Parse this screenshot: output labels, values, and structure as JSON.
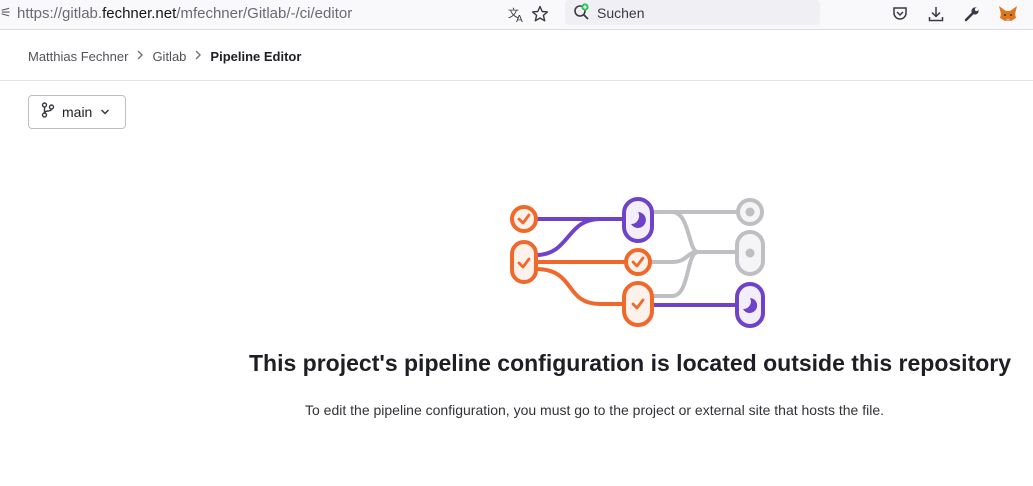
{
  "browser": {
    "url_prefix": "https://gitlab.",
    "url_host": "fechner.net",
    "url_path": "/mfechner/Gitlab/-/ci/editor",
    "search_placeholder": "Suchen"
  },
  "breadcrumb": {
    "items": [
      "Matthias Fechner",
      "Gitlab"
    ],
    "current": "Pipeline Editor"
  },
  "branch_selector": {
    "label": "main"
  },
  "empty_state": {
    "title": "This project's pipeline configuration is located outside this repository",
    "description": "To edit the pipeline configuration, you must go to the project or external site that hosts the file."
  },
  "colors": {
    "orange": "#f0692b",
    "purple": "#6f43c9",
    "gray": "#bfbfc3"
  }
}
